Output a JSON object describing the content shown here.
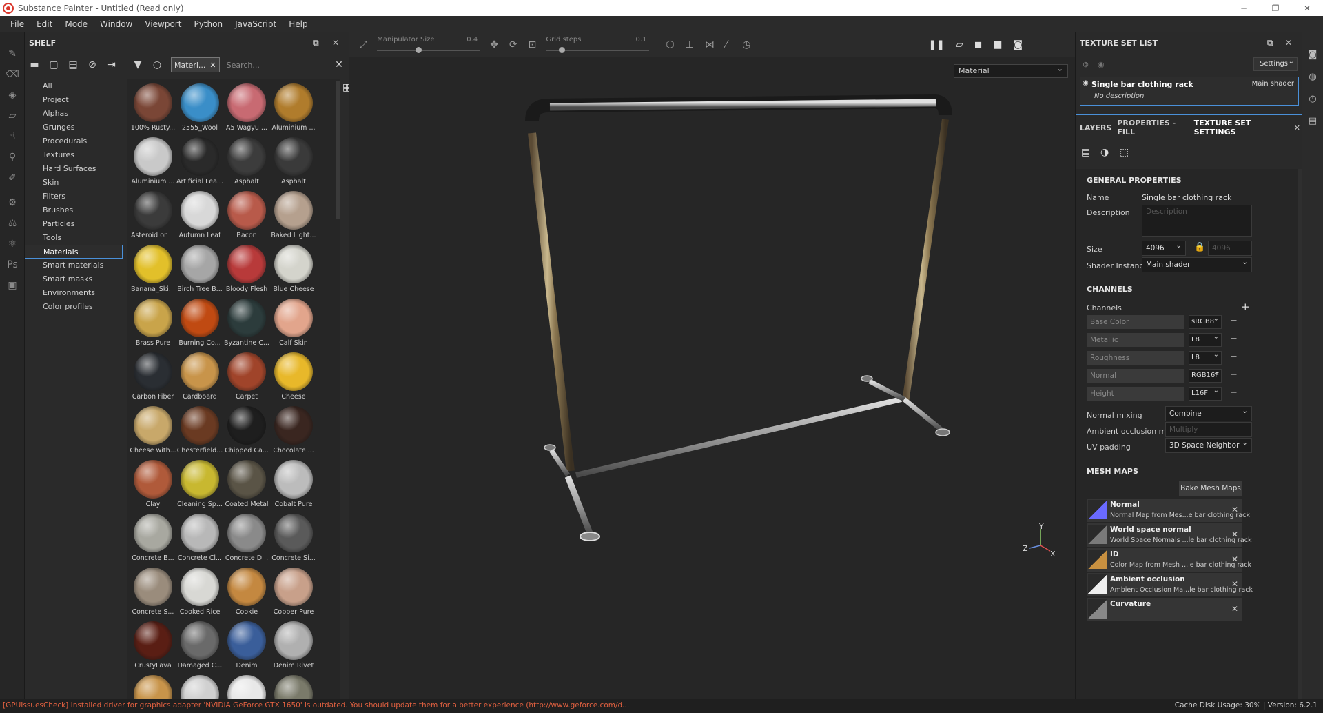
{
  "window": {
    "title": "Substance Painter - Untitled (Read only)",
    "controls": [
      "─",
      "❐",
      "✕"
    ]
  },
  "menu": [
    "File",
    "Edit",
    "Mode",
    "Window",
    "Viewport",
    "Python",
    "JavaScript",
    "Help"
  ],
  "shelf": {
    "title": "SHELF",
    "filter_chip": "Materi...",
    "search_placeholder": "Search...",
    "categories": [
      "All",
      "Project",
      "Alphas",
      "Grunges",
      "Procedurals",
      "Textures",
      "Hard Surfaces",
      "Skin",
      "Filters",
      "Brushes",
      "Particles",
      "Tools",
      "Materials",
      "Smart materials",
      "Smart masks",
      "Environments",
      "Color profiles"
    ],
    "selected_category": "Materials",
    "materials": [
      {
        "label": "100% Rusty...",
        "color": "#7a4636"
      },
      {
        "label": "2555_Wool",
        "color": "#3a8ec8"
      },
      {
        "label": "A5 Wagyu ...",
        "color": "#c86a72"
      },
      {
        "label": "Aluminium ...",
        "color": "#b07c2c"
      },
      {
        "label": "Aluminium ...",
        "color": "#c9c9c9"
      },
      {
        "label": "Artificial Lea...",
        "color": "#2a2a2a"
      },
      {
        "label": "Asphalt",
        "color": "#3c3c3c"
      },
      {
        "label": "Asphalt",
        "color": "#3a3a3a"
      },
      {
        "label": "Asteroid or ...",
        "color": "#3b3b3b"
      },
      {
        "label": "Autumn Leaf",
        "color": "#d8d8d8"
      },
      {
        "label": "Bacon",
        "color": "#b85a4a"
      },
      {
        "label": "Baked Light...",
        "color": "#b5a08e"
      },
      {
        "label": "Banana_Ski...",
        "color": "#e2c02a"
      },
      {
        "label": "Birch Tree B...",
        "color": "#a6a6a6"
      },
      {
        "label": "Bloody Flesh",
        "color": "#b83a3a"
      },
      {
        "label": "Blue Cheese",
        "color": "#d4d4cc"
      },
      {
        "label": "Brass Pure",
        "color": "#c9a44a"
      },
      {
        "label": "Burning Co...",
        "color": "#c04a12"
      },
      {
        "label": "Byzantine C...",
        "color": "#2c3c3c"
      },
      {
        "label": "Calf Skin",
        "color": "#e2a58c"
      },
      {
        "label": "Carbon Fiber",
        "color": "#2a2e33"
      },
      {
        "label": "Cardboard",
        "color": "#c8944a"
      },
      {
        "label": "Carpet",
        "color": "#a0442a"
      },
      {
        "label": "Cheese",
        "color": "#e8b82a"
      },
      {
        "label": "Cheese with...",
        "color": "#c8a86a"
      },
      {
        "label": "Chesterfield...",
        "color": "#6a3a22"
      },
      {
        "label": "Chipped Ca...",
        "color": "#1e1e1e"
      },
      {
        "label": "Chocolate ...",
        "color": "#3a2620"
      },
      {
        "label": "Clay",
        "color": "#b05a3a"
      },
      {
        "label": "Cleaning Sp...",
        "color": "#c8b830"
      },
      {
        "label": "Coated Metal",
        "color": "#5a5446"
      },
      {
        "label": "Cobalt Pure",
        "color": "#bcbcbc"
      },
      {
        "label": "Concrete B...",
        "color": "#a8a8a0"
      },
      {
        "label": "Concrete Cl...",
        "color": "#b8b8b8"
      },
      {
        "label": "Concrete D...",
        "color": "#8a8a8a"
      },
      {
        "label": "Concrete Si...",
        "color": "#5a5a5a"
      },
      {
        "label": "Concrete S...",
        "color": "#9a8c7c"
      },
      {
        "label": "Cooked Rice",
        "color": "#d8d8d4"
      },
      {
        "label": "Cookie",
        "color": "#c48840"
      },
      {
        "label": "Copper Pure",
        "color": "#c8a08a"
      },
      {
        "label": "CrustyLava",
        "color": "#5a1e14"
      },
      {
        "label": "Damaged C...",
        "color": "#6a6a6a"
      },
      {
        "label": "Denim",
        "color": "#3a5e9a"
      },
      {
        "label": "Denim Rivet",
        "color": "#b0b0b0"
      },
      {
        "label": "",
        "color": "#c8944a"
      },
      {
        "label": "",
        "color": "#d0d0d0"
      },
      {
        "label": "",
        "color": "#e8e8e8"
      },
      {
        "label": "",
        "color": "#7a7a6a"
      }
    ]
  },
  "viewport": {
    "manipulator_label": "Manipulator Size",
    "manipulator_value": "0.4",
    "manipulator_level": 0.4,
    "grid_label": "Grid steps",
    "grid_value": "0.1",
    "grid_level": 0.1,
    "material_dropdown": "Material",
    "axis_y": "Y",
    "axis_z": "Z",
    "axis_x": "X"
  },
  "texture_set_list": {
    "title": "TEXTURE SET LIST",
    "settings_label": "Settings",
    "item_name": "Single bar clothing rack",
    "item_shader": "Main shader",
    "item_description": "No description"
  },
  "tabs": [
    "LAYERS",
    "PROPERTIES - FILL",
    "TEXTURE SET SETTINGS"
  ],
  "settings": {
    "general_title": "GENERAL PROPERTIES",
    "name_label": "Name",
    "name_value": "Single bar clothing rack",
    "description_label": "Description",
    "description_placeholder": "Description",
    "size_label": "Size",
    "size_value": "4096",
    "size_value_locked": "4096",
    "shader_label": "Shader Instance",
    "shader_value": "Main shader",
    "channels_title": "CHANNELS",
    "channels_label": "Channels",
    "channels": [
      {
        "name": "Base Color",
        "format": "sRGB8"
      },
      {
        "name": "Metallic",
        "format": "L8"
      },
      {
        "name": "Roughness",
        "format": "L8"
      },
      {
        "name": "Normal",
        "format": "RGB16F"
      },
      {
        "name": "Height",
        "format": "L16F"
      }
    ],
    "normal_mixing_label": "Normal mixing",
    "normal_mixing_value": "Combine",
    "ao_mixing_label": "Ambient occlusion mixing",
    "ao_mixing_value": "Multiply",
    "uv_padding_label": "UV padding",
    "uv_padding_value": "3D Space Neighbor",
    "mesh_maps_title": "MESH MAPS",
    "bake_label": "Bake Mesh Maps",
    "mesh_maps": [
      {
        "title": "Normal",
        "subtitle": "Normal Map from Mes...e bar clothing rack"
      },
      {
        "title": "World space normal",
        "subtitle": "World Space Normals ...le bar clothing rack"
      },
      {
        "title": "ID",
        "subtitle": "Color Map from Mesh ...le bar clothing rack"
      },
      {
        "title": "Ambient occlusion",
        "subtitle": "Ambient Occlusion Ma...le bar clothing rack"
      },
      {
        "title": "Curvature",
        "subtitle": ""
      }
    ]
  },
  "status": {
    "error": "[GPUIssuesCheck] Installed driver for graphics adapter 'NVIDIA GeForce GTX 1650' is outdated. You should update them for a better experience (http://www.geforce.com/d...",
    "cache": "Cache Disk Usage:   30% | Version: 6.2.1"
  }
}
